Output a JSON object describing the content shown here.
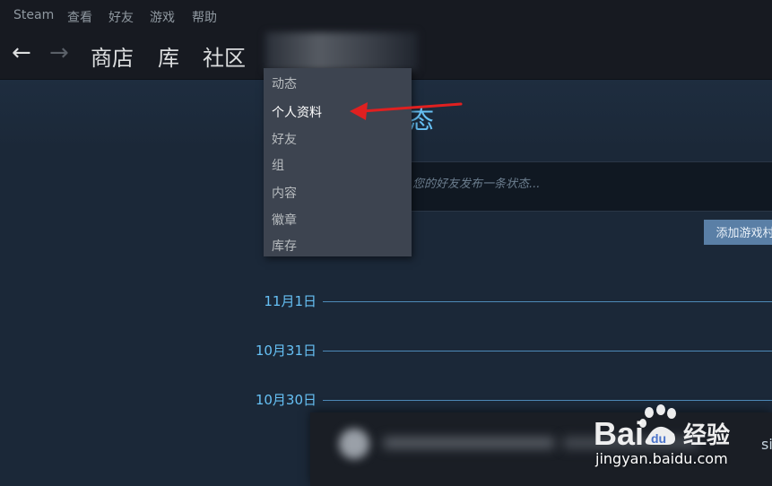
{
  "menubar": {
    "items": [
      "Steam",
      "查看",
      "好友",
      "游戏",
      "帮助"
    ]
  },
  "navbar": {
    "back_icon": "arrow-left-icon",
    "forward_icon": "arrow-right-icon",
    "tabs": [
      "商店",
      "库",
      "社区"
    ]
  },
  "dropdown": {
    "items": [
      "动态",
      "个人资料",
      "好友",
      "组",
      "内容",
      "徽章",
      "库存"
    ],
    "highlighted_index": 1
  },
  "page": {
    "title_fragment": "态",
    "status_placeholder": "您的好友发布一条状态...",
    "add_button_label": "添加游戏村"
  },
  "timeline": {
    "dates": [
      "11月1日",
      "10月31日",
      "10月30日"
    ]
  },
  "popup": {
    "edge_text": "si"
  },
  "watermark": {
    "logo_text": "Baidu经验",
    "url": "jingyan.baidu.com"
  },
  "colors": {
    "accent": "#66c0f4",
    "annotation_arrow": "#e02020",
    "background": "#1b2838",
    "menubar": "#171a21",
    "dropdown": "#3d4450"
  }
}
